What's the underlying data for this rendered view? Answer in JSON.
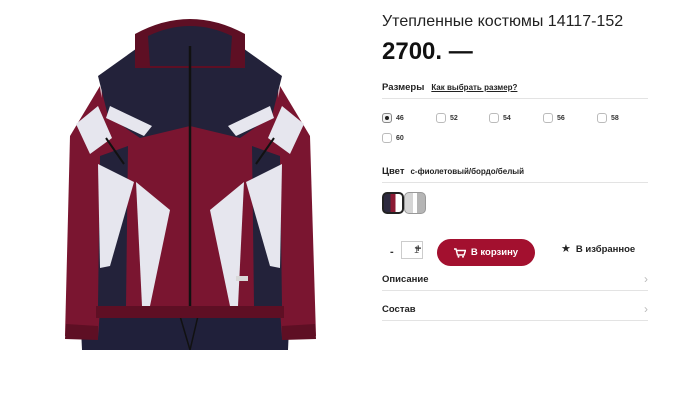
{
  "product": {
    "title": "Утепленные костюмы 14117-152",
    "price": "2700. —"
  },
  "sizes": {
    "label": "Размеры",
    "guide_link": "Как выбрать размер?",
    "options": [
      {
        "value": "46",
        "selected": true
      },
      {
        "value": "52",
        "selected": false
      },
      {
        "value": "54",
        "selected": false
      },
      {
        "value": "56",
        "selected": false
      },
      {
        "value": "58",
        "selected": false
      },
      {
        "value": "60",
        "selected": false
      }
    ]
  },
  "color": {
    "label": "Цвет",
    "value": "с-фиолетовый/бордо/белый",
    "swatches": [
      {
        "colors": [
          "#2d2a3f",
          "#8c1a33",
          "#ffffff"
        ],
        "selected": true
      },
      {
        "colors": [
          "#d5d5d5",
          "#ffffff",
          "#b5b5b5"
        ],
        "selected": false
      }
    ]
  },
  "quantity": {
    "minus": "-",
    "value": "1",
    "plus": "+"
  },
  "actions": {
    "cart_label": "В корзину",
    "favorite_label": "В избранное"
  },
  "accordion": [
    {
      "label": "Описание"
    },
    {
      "label": "Состав"
    }
  ],
  "colors": {
    "accent": "#a3102f",
    "jacket_burgundy": "#7a1530",
    "jacket_navy": "#23223a"
  },
  "icons": [
    "cart-icon",
    "star-icon",
    "chevron-right-icon"
  ]
}
